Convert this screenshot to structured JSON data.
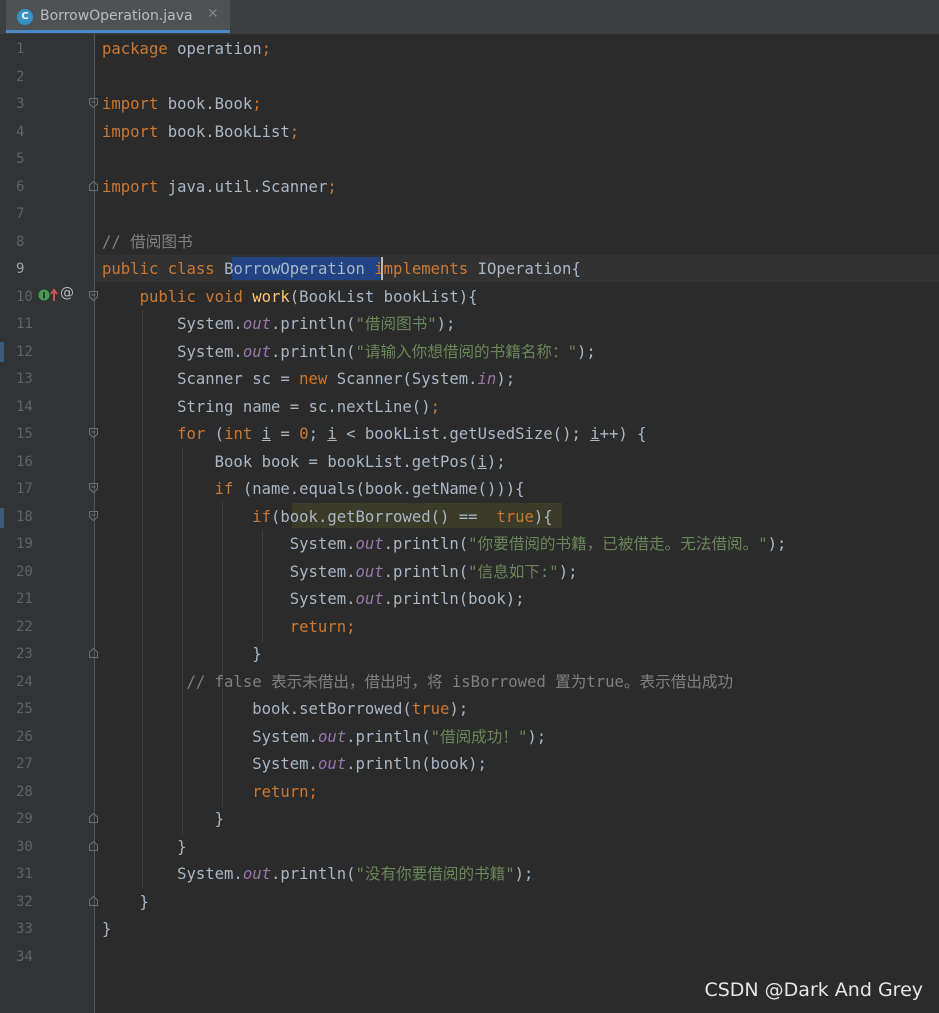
{
  "tab": {
    "icon_letter": "C",
    "title": "BorrowOperation.java",
    "close_glyph": "✕"
  },
  "watermark": "CSDN @Dark And Grey",
  "colors": {
    "keyword": "#cc7832",
    "string": "#6a8759",
    "field": "#9876aa",
    "method": "#ffc66d",
    "comment": "#808080",
    "text": "#a9b7c6",
    "background": "#2b2b2b"
  },
  "gutter_markers": {
    "implements_icon": "implements-method-icon",
    "annotation": "@"
  },
  "current_line": 9,
  "lines": [
    {
      "n": "1",
      "segs": [
        [
          "package",
          "kw"
        ],
        [
          " operation",
          ""
        ],
        [
          ";",
          "kw"
        ]
      ]
    },
    {
      "n": "2",
      "segs": []
    },
    {
      "n": "3",
      "segs": [
        [
          "import",
          "kw"
        ],
        [
          " book.Book",
          ""
        ],
        [
          ";",
          "kw"
        ]
      ]
    },
    {
      "n": "4",
      "segs": [
        [
          "import",
          "kw"
        ],
        [
          " book.BookList",
          ""
        ],
        [
          ";",
          "kw"
        ]
      ]
    },
    {
      "n": "5",
      "segs": []
    },
    {
      "n": "6",
      "segs": [
        [
          "import",
          "kw"
        ],
        [
          " java.util.Scanner",
          ""
        ],
        [
          ";",
          "kw"
        ]
      ]
    },
    {
      "n": "7",
      "segs": []
    },
    {
      "n": "8",
      "segs": [
        [
          "// 借阅图书",
          "cmt"
        ]
      ]
    },
    {
      "n": "9",
      "segs": [
        [
          "public class ",
          "kw"
        ],
        [
          "BorrowOperation",
          ""
        ],
        [
          " implements ",
          "kw"
        ],
        [
          "IOperation{",
          ""
        ]
      ]
    },
    {
      "n": "10",
      "segs": [
        [
          "    ",
          ""
        ],
        [
          "public void ",
          "kw"
        ],
        [
          "work",
          "mth"
        ],
        [
          "(BookList bookList){",
          ""
        ]
      ]
    },
    {
      "n": "11",
      "segs": [
        [
          "        System.",
          ""
        ],
        [
          "out",
          "fld"
        ],
        [
          ".println(",
          ""
        ],
        [
          "\"借阅图书\"",
          "str"
        ],
        [
          ");",
          ""
        ]
      ]
    },
    {
      "n": "12",
      "segs": [
        [
          "        System.",
          ""
        ],
        [
          "out",
          "fld"
        ],
        [
          ".println(",
          ""
        ],
        [
          "\"请输入你想借阅的书籍名称：\"",
          "str"
        ],
        [
          ");",
          ""
        ]
      ]
    },
    {
      "n": "13",
      "segs": [
        [
          "        Scanner sc = ",
          ""
        ],
        [
          "new ",
          "kw"
        ],
        [
          "Scanner(System.",
          ""
        ],
        [
          "in",
          "fld"
        ],
        [
          ");",
          ""
        ]
      ]
    },
    {
      "n": "14",
      "segs": [
        [
          "        String name = sc.nextLine()",
          ""
        ],
        [
          ";",
          "kw"
        ]
      ]
    },
    {
      "n": "15",
      "segs": [
        [
          "        ",
          ""
        ],
        [
          "for ",
          "kw"
        ],
        [
          "(",
          ""
        ],
        [
          "int ",
          "kw"
        ],
        [
          "i",
          "ul"
        ],
        [
          " = ",
          ""
        ],
        [
          "0",
          "kw"
        ],
        [
          "; ",
          ""
        ],
        [
          "i",
          "ul"
        ],
        [
          " < bookList.getUsedSize(); ",
          ""
        ],
        [
          "i",
          "ul"
        ],
        [
          "++) {",
          ""
        ]
      ]
    },
    {
      "n": "16",
      "segs": [
        [
          "            Book book = bookList.getPos(",
          ""
        ],
        [
          "i",
          "ul"
        ],
        [
          ");",
          ""
        ]
      ]
    },
    {
      "n": "17",
      "segs": [
        [
          "            ",
          ""
        ],
        [
          "if ",
          "kw"
        ],
        [
          "(name.equals(book.getName())){",
          ""
        ]
      ]
    },
    {
      "n": "18",
      "segs": [
        [
          "                ",
          ""
        ],
        [
          "if",
          "kw"
        ],
        [
          "(book.getBorrowed() ==  ",
          ""
        ],
        [
          "true",
          "kw"
        ],
        [
          "){",
          ""
        ]
      ]
    },
    {
      "n": "19",
      "segs": [
        [
          "                    System.",
          ""
        ],
        [
          "out",
          "fld"
        ],
        [
          ".println(",
          ""
        ],
        [
          "\"你要借阅的书籍，已被借走。无法借阅。\"",
          "str"
        ],
        [
          ");",
          ""
        ]
      ]
    },
    {
      "n": "20",
      "segs": [
        [
          "                    System.",
          ""
        ],
        [
          "out",
          "fld"
        ],
        [
          ".println(",
          ""
        ],
        [
          "\"信息如下:\"",
          "str"
        ],
        [
          ");",
          ""
        ]
      ]
    },
    {
      "n": "21",
      "segs": [
        [
          "                    System.",
          ""
        ],
        [
          "out",
          "fld"
        ],
        [
          ".println(book);",
          ""
        ]
      ]
    },
    {
      "n": "22",
      "segs": [
        [
          "                    ",
          ""
        ],
        [
          "return;",
          "kw"
        ]
      ]
    },
    {
      "n": "23",
      "segs": [
        [
          "                }",
          ""
        ]
      ]
    },
    {
      "n": "24",
      "segs": [
        [
          "         // false 表示未借出，借出时，将 isBorrowed 置为true。表示借出成功",
          "cmt"
        ]
      ]
    },
    {
      "n": "25",
      "segs": [
        [
          "                book.setBorrowed(",
          ""
        ],
        [
          "true",
          "kw"
        ],
        [
          ");",
          ""
        ]
      ]
    },
    {
      "n": "26",
      "segs": [
        [
          "                System.",
          ""
        ],
        [
          "out",
          "fld"
        ],
        [
          ".println(",
          ""
        ],
        [
          "\"借阅成功！\"",
          "str"
        ],
        [
          ");",
          ""
        ]
      ]
    },
    {
      "n": "27",
      "segs": [
        [
          "                System.",
          ""
        ],
        [
          "out",
          "fld"
        ],
        [
          ".println(book);",
          ""
        ]
      ]
    },
    {
      "n": "28",
      "segs": [
        [
          "                ",
          ""
        ],
        [
          "return;",
          "kw"
        ]
      ]
    },
    {
      "n": "29",
      "segs": [
        [
          "            }",
          ""
        ]
      ]
    },
    {
      "n": "30",
      "segs": [
        [
          "        }",
          ""
        ]
      ]
    },
    {
      "n": "31",
      "segs": [
        [
          "        System.",
          ""
        ],
        [
          "out",
          "fld"
        ],
        [
          ".println(",
          ""
        ],
        [
          "\"没有你要借阅的书籍\"",
          "str"
        ],
        [
          ");",
          ""
        ]
      ]
    },
    {
      "n": "32",
      "segs": [
        [
          "    }",
          ""
        ]
      ]
    },
    {
      "n": "33",
      "segs": [
        [
          "}",
          ""
        ]
      ]
    },
    {
      "n": "34",
      "segs": []
    }
  ]
}
